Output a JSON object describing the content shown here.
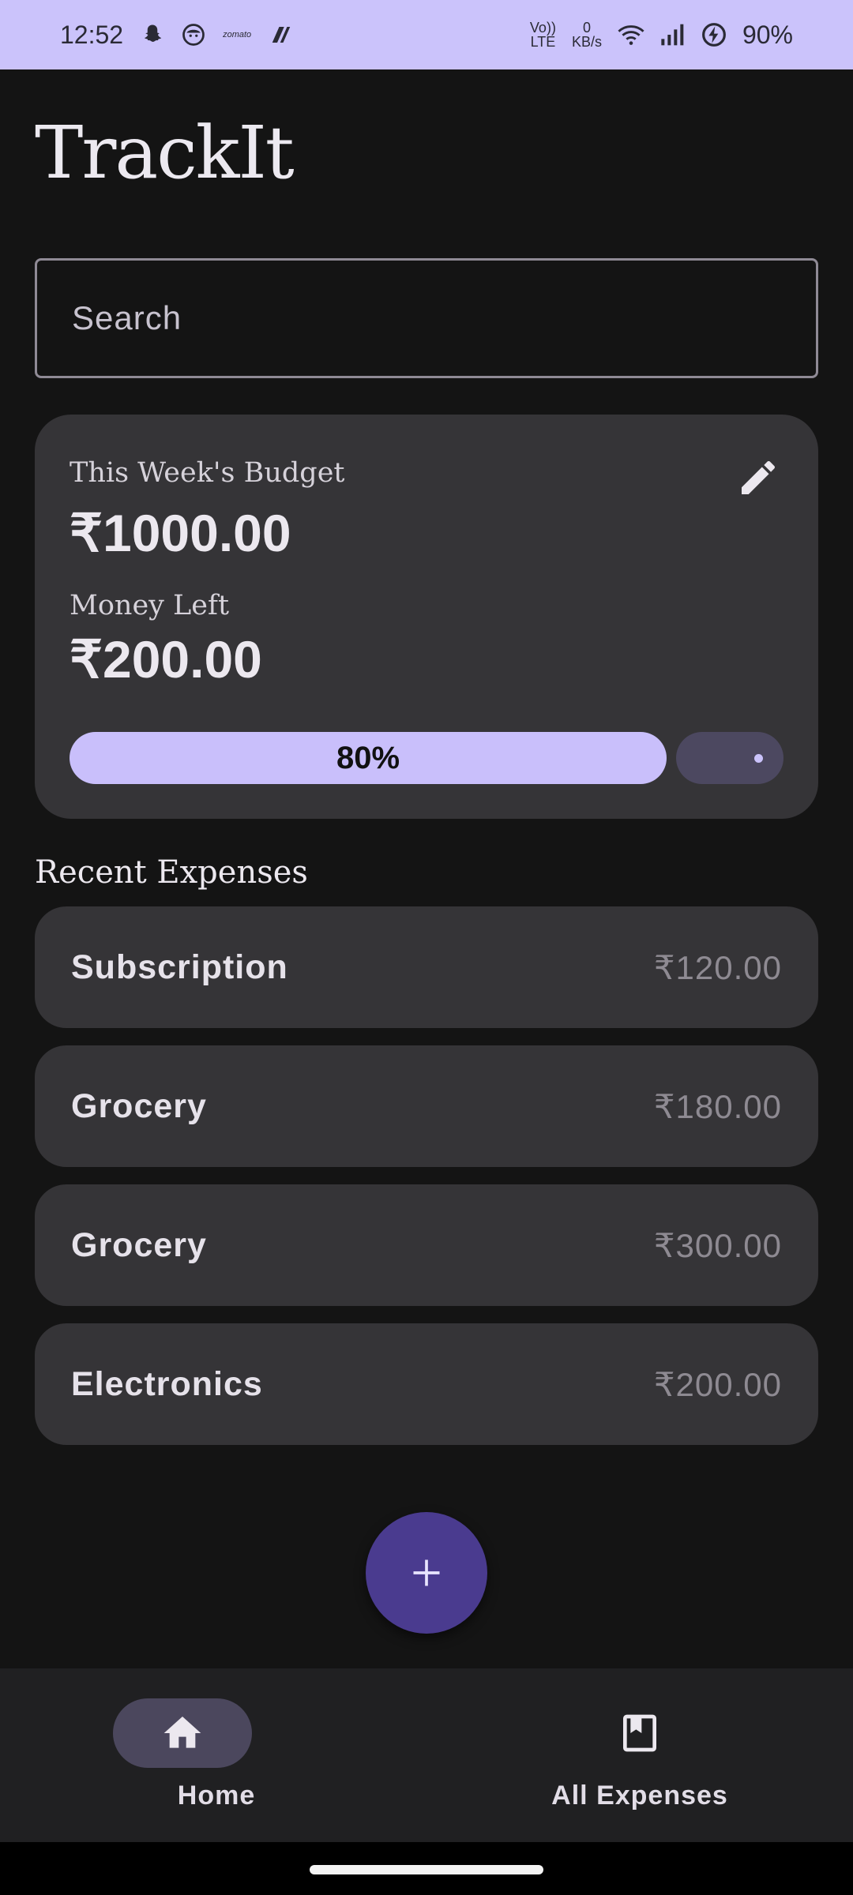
{
  "status_bar": {
    "time": "12:52",
    "left_icons": [
      "snapchat-icon",
      "face-icon",
      "zomato-icon",
      "app-icon"
    ],
    "zomato_text": "zomato",
    "volte_top": "Vo))",
    "volte_bottom": "LTE",
    "speed_value": "0",
    "speed_unit": "KB/s",
    "battery": "90%",
    "accent": "#cbc3fb"
  },
  "app": {
    "title": "TrackIt"
  },
  "search": {
    "placeholder": "Search"
  },
  "budget": {
    "label": "This Week's Budget",
    "amount": "₹1000.00",
    "left_label": "Money Left",
    "left_amount": "₹200.00",
    "progress_text": "80%",
    "progress_fraction": 0.8,
    "fill_color": "#c9bffb"
  },
  "recent": {
    "title": "Recent Expenses",
    "items": [
      {
        "name": "Subscription",
        "amount": "₹120.00"
      },
      {
        "name": "Grocery",
        "amount": "₹180.00"
      },
      {
        "name": "Grocery",
        "amount": "₹300.00"
      },
      {
        "name": "Electronics",
        "amount": "₹200.00"
      }
    ]
  },
  "fab": {
    "icon": "plus-icon"
  },
  "nav": {
    "items": [
      {
        "label": "Home",
        "icon": "home-icon",
        "active": true
      },
      {
        "label": "All Expenses",
        "icon": "bookmark-icon",
        "active": false
      }
    ]
  }
}
